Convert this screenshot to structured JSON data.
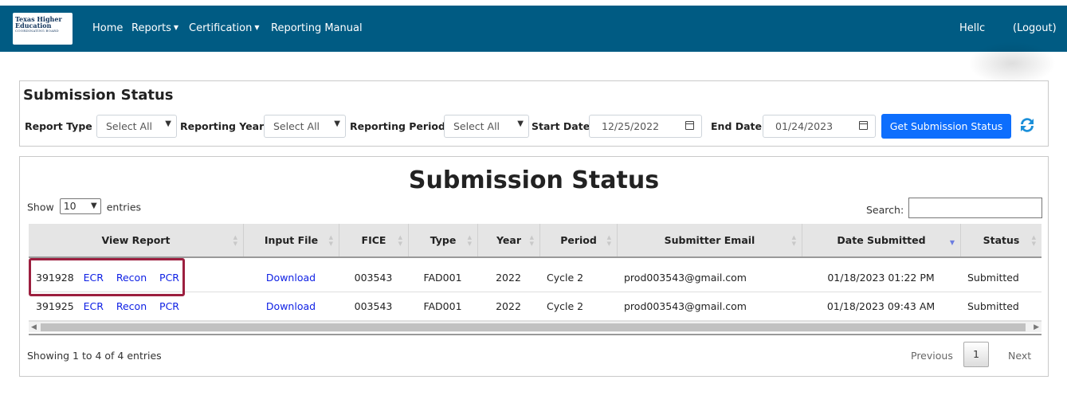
{
  "navbar": {
    "logo": {
      "line1": "Texas Higher",
      "line2": "Education",
      "line3": "COORDINATING BOARD"
    },
    "links": [
      "Home",
      "Reports",
      "Certification",
      "Reporting Manual"
    ],
    "greeting": "Hellc",
    "logout": "(Logout)",
    "background": "#005b83"
  },
  "filters": {
    "title": "Submission Status",
    "report_type_label": "Report Type",
    "report_type_value": "Select All",
    "reporting_year_label": "Reporting Year",
    "reporting_year_value": "Select All",
    "reporting_period_label": "Reporting Period",
    "reporting_period_value": "Select All",
    "start_date_label": "Start Date",
    "start_date_value": "12/25/2022",
    "end_date_label": "End Date",
    "end_date_value": "01/24/2023",
    "get_button": "Get Submission Status",
    "button_color": "#0d6efd"
  },
  "table": {
    "title": "Submission Status",
    "show_label": "Show",
    "entries_value": "10",
    "entries_label": "entries",
    "search_label": "Search:",
    "columns": [
      "View Report",
      "Input File",
      "FICE",
      "Type",
      "Year",
      "Period",
      "Submitter Email",
      "Date Submitted",
      "Status"
    ],
    "rows": [
      {
        "id": "391928",
        "links": [
          "ECR",
          "Recon",
          "PCR"
        ],
        "input_file": "Download",
        "fice": "003543",
        "type": "FAD001",
        "year": "2022",
        "period": "Cycle 2",
        "email": "prod003543@gmail.com",
        "date": "01/18/2023 01:22 PM",
        "status": "Submitted"
      },
      {
        "id": "391925",
        "links": [
          "ECR",
          "Recon",
          "PCR"
        ],
        "input_file": "Download",
        "fice": "003543",
        "type": "FAD001",
        "year": "2022",
        "period": "Cycle 2",
        "email": "prod003543@gmail.com",
        "date": "01/18/2023 09:43 AM",
        "status": "Submitted"
      }
    ],
    "info": "Showing 1 to 4 of 4 entries",
    "previous": "Previous",
    "page": "1",
    "next": "Next",
    "highlight_color": "#9c1f3f",
    "link_color": "#0d1fe4"
  }
}
